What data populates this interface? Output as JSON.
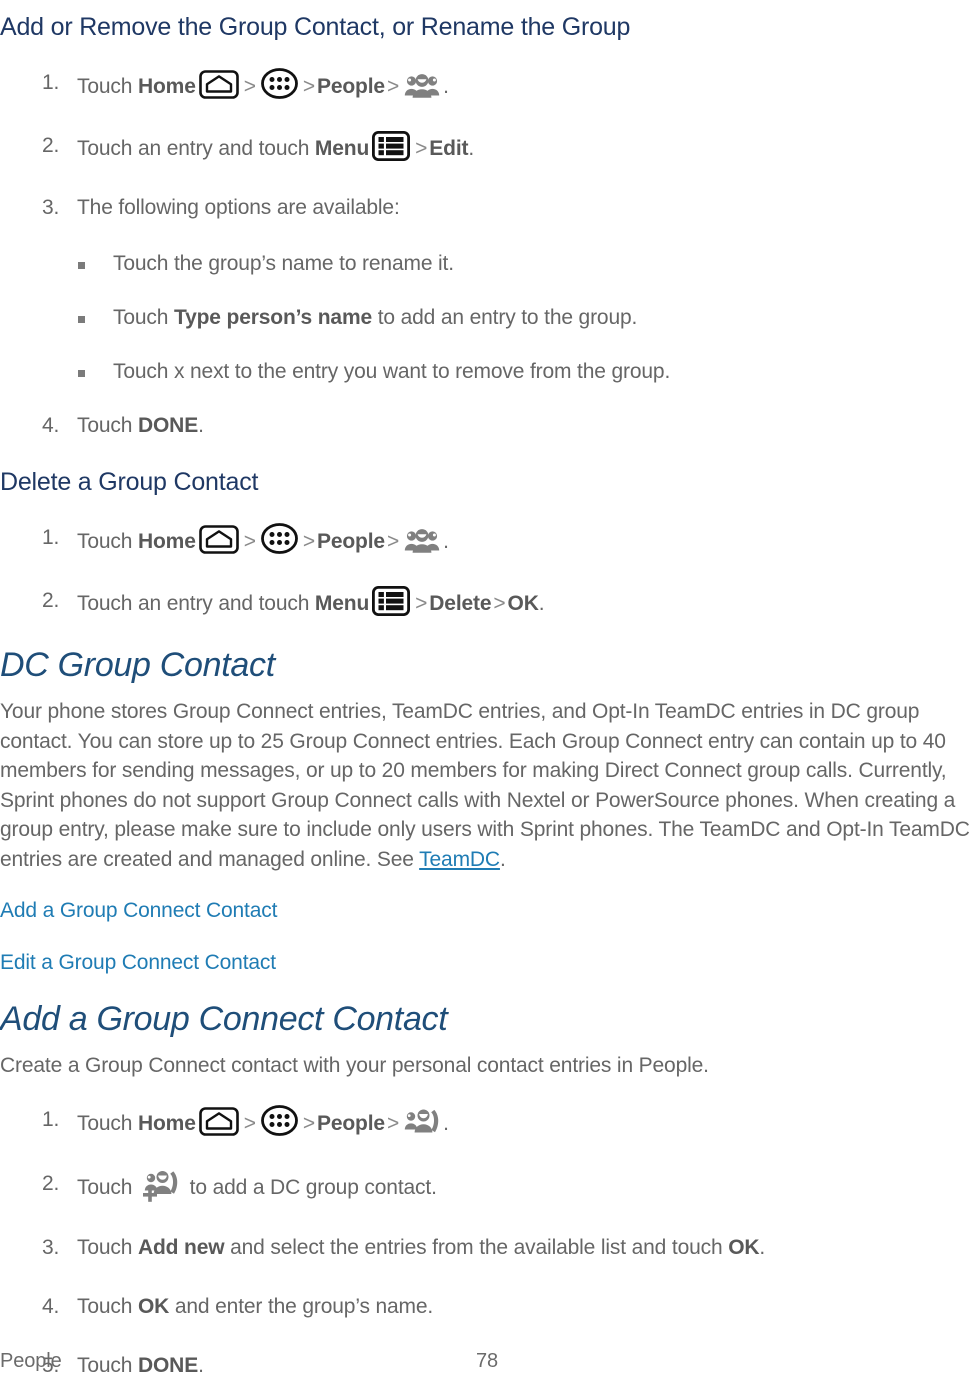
{
  "colors": {
    "heading3": "#1F3864",
    "heading2": "#1F4E79",
    "body_text": "#666666",
    "link": "#2382B8",
    "bullet": "#7B7B7B",
    "icon_gray": "#808080",
    "icon_black": "#111111"
  },
  "sections": [
    {
      "id": "add-remove-group-contact",
      "heading": "Add or Remove the Group Contact, or Rename the Group",
      "heading_level": 3,
      "steps": [
        {
          "num": "1.",
          "parts": [
            {
              "type": "text",
              "value": "Touch "
            },
            {
              "type": "bold",
              "value": "Home"
            },
            {
              "type": "icon",
              "name": "home-icon"
            },
            {
              "type": "gt",
              "value": ">"
            },
            {
              "type": "icon",
              "name": "apps-icon"
            },
            {
              "type": "gt",
              "value": ">"
            },
            {
              "type": "bold",
              "value": "People"
            },
            {
              "type": "gt",
              "value": ">"
            },
            {
              "type": "icon",
              "name": "people-group-icon"
            },
            {
              "type": "text",
              "value": "."
            }
          ]
        },
        {
          "num": "2.",
          "parts": [
            {
              "type": "text",
              "value": "Touch an entry and touch "
            },
            {
              "type": "bold",
              "value": "Menu"
            },
            {
              "type": "icon",
              "name": "menu-icon"
            },
            {
              "type": "gt",
              "value": ">"
            },
            {
              "type": "bold",
              "value": "Edit"
            },
            {
              "type": "text",
              "value": "."
            }
          ]
        },
        {
          "num": "3.",
          "parts": [
            {
              "type": "text",
              "value": "The following options are available:"
            }
          ]
        }
      ],
      "bullets": [
        [
          {
            "type": "text",
            "value": "Touch the group’s name to rename it."
          }
        ],
        [
          {
            "type": "text",
            "value": "Touch "
          },
          {
            "type": "bold",
            "value": "Type person’s name"
          },
          {
            "type": "text",
            "value": " to add an entry to the group."
          }
        ],
        [
          {
            "type": "text",
            "value": "Touch x next to the entry you want to remove from the group."
          }
        ]
      ],
      "steps_after": [
        {
          "num": "4.",
          "parts": [
            {
              "type": "text",
              "value": "Touch "
            },
            {
              "type": "bold",
              "value": "DONE"
            },
            {
              "type": "text",
              "value": "."
            }
          ]
        }
      ]
    },
    {
      "id": "delete-group-contact",
      "heading": "Delete a Group Contact",
      "heading_level": 3,
      "steps": [
        {
          "num": "1.",
          "parts": [
            {
              "type": "text",
              "value": "Touch "
            },
            {
              "type": "bold",
              "value": "Home"
            },
            {
              "type": "icon",
              "name": "home-icon"
            },
            {
              "type": "gt",
              "value": ">"
            },
            {
              "type": "icon",
              "name": "apps-icon"
            },
            {
              "type": "gt",
              "value": ">"
            },
            {
              "type": "bold",
              "value": "People"
            },
            {
              "type": "gt",
              "value": ">"
            },
            {
              "type": "icon",
              "name": "people-group-icon"
            },
            {
              "type": "text",
              "value": "."
            }
          ]
        },
        {
          "num": "2.",
          "parts": [
            {
              "type": "text",
              "value": "Touch an entry and touch "
            },
            {
              "type": "bold",
              "value": "Menu"
            },
            {
              "type": "icon",
              "name": "menu-icon"
            },
            {
              "type": "gt",
              "value": ">"
            },
            {
              "type": "bold",
              "value": "Delete"
            },
            {
              "type": "gt",
              "value": ">"
            },
            {
              "type": "bold",
              "value": "OK"
            },
            {
              "type": "text",
              "value": "."
            }
          ]
        }
      ]
    },
    {
      "id": "dc-group-contact",
      "heading": "DC Group Contact",
      "heading_level": 2,
      "paragraph_parts": [
        {
          "type": "text",
          "value": "Your phone stores Group Connect entries, TeamDC entries, and Opt-In TeamDC entries in DC group contact. You can store up to 25 Group Connect entries. Each Group Connect entry can contain up to 40 members for sending messages, or up to 20 members for making Direct Connect group calls. Currently, Sprint phones do not support Group Connect calls with Nextel or PowerSource phones. When creating a group entry, please make sure to include only users with Sprint phones. The TeamDC and Opt-In TeamDC entries are created and managed online. See "
        },
        {
          "type": "link",
          "value": "TeamDC"
        },
        {
          "type": "text",
          "value": "."
        }
      ],
      "links": [
        "Add a Group Connect Contact",
        "Edit a Group Connect Contact"
      ]
    },
    {
      "id": "add-group-connect-contact",
      "heading": "Add a Group Connect Contact",
      "heading_level": 2,
      "intro": "Create a Group Connect contact with your personal contact entries in People.",
      "steps": [
        {
          "num": "1.",
          "parts": [
            {
              "type": "text",
              "value": "Touch "
            },
            {
              "type": "bold",
              "value": "Home"
            },
            {
              "type": "icon",
              "name": "home-icon"
            },
            {
              "type": "gt",
              "value": ">"
            },
            {
              "type": "icon",
              "name": "apps-icon"
            },
            {
              "type": "gt",
              "value": ">"
            },
            {
              "type": "bold",
              "value": "People"
            },
            {
              "type": "gt",
              "value": ">"
            },
            {
              "type": "icon",
              "name": "dc-group-icon"
            },
            {
              "type": "text",
              "value": "."
            }
          ]
        },
        {
          "num": "2.",
          "parts": [
            {
              "type": "text",
              "value": "Touch "
            },
            {
              "type": "icon",
              "name": "add-dc-group-icon"
            },
            {
              "type": "text",
              "value": " to add a DC group contact."
            }
          ]
        },
        {
          "num": "3.",
          "parts": [
            {
              "type": "text",
              "value": "Touch "
            },
            {
              "type": "bold",
              "value": "Add new"
            },
            {
              "type": "text",
              "value": " and select the entries from the available list and touch "
            },
            {
              "type": "bold",
              "value": "OK"
            },
            {
              "type": "text",
              "value": "."
            }
          ]
        },
        {
          "num": "4.",
          "parts": [
            {
              "type": "text",
              "value": "Touch "
            },
            {
              "type": "bold",
              "value": "OK"
            },
            {
              "type": "text",
              "value": " and enter the group’s name."
            }
          ]
        },
        {
          "num": "5.",
          "parts": [
            {
              "type": "text",
              "value": "Touch "
            },
            {
              "type": "bold",
              "value": "DONE"
            },
            {
              "type": "text",
              "value": "."
            }
          ]
        }
      ]
    }
  ],
  "footer": {
    "chapter": "People",
    "page_number": "78"
  }
}
